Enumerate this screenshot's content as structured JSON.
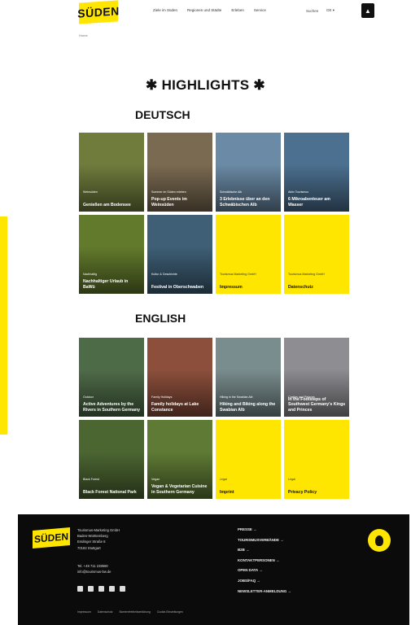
{
  "header": {
    "logo": "SÜDEN",
    "nav": [
      "Ziele im Süden",
      "Regionen und Städte",
      "Erleben",
      "Service"
    ],
    "search_label": "Suchen",
    "lang_label": "DE ▾"
  },
  "breadcrumb": "Home",
  "highlights_title": "✱ HIGHLIGHTS ✱",
  "sections": [
    {
      "heading": "DEUTSCH",
      "tiles": [
        {
          "category": "Weinsüden",
          "title": "Genießen am Bodensee",
          "type": "img",
          "color": "#6f7c3c"
        },
        {
          "category": "Sommer im Süden erleben",
          "title": "Pop-up Events im Weinsüden",
          "type": "img",
          "color": "#7b6a52"
        },
        {
          "category": "Schwäbische Alb",
          "title": "3 Erlebnisse über an den Schwäbischen Alb",
          "type": "img",
          "color": "#6b8aa5"
        },
        {
          "category": "Aktiv Tourismus",
          "title": "6 Mikroabenteuer am Wasser",
          "type": "img",
          "color": "#4c7090"
        },
        {
          "category": "Nachhaltig",
          "title": "Nachhaltiger Urlaub in BaWü",
          "type": "img",
          "color": "#627a2c"
        },
        {
          "category": "Kultur & Geschichte",
          "title": "Festival in Oberschwaben",
          "type": "img",
          "color": "#3e5f76"
        },
        {
          "category": "Tourismus Marketing GmbH",
          "title": "Impressum",
          "type": "yellow",
          "color": "#ffe600"
        },
        {
          "category": "Tourismus Marketing GmbH",
          "title": "Datenschutz",
          "type": "yellow",
          "color": "#ffe600"
        }
      ]
    },
    {
      "heading": "ENGLISH",
      "tiles": [
        {
          "category": "Outdoor",
          "title": "Active Adventures by the Rivers in Southern Germany",
          "type": "img",
          "color": "#4e6b48"
        },
        {
          "category": "Family Holidays",
          "title": "Family holidays at Lake Constance",
          "type": "img",
          "color": "#8c4f3c"
        },
        {
          "category": "Hiking in the Swabian Alb",
          "title": "Hiking and Biking along the Swabian Alb",
          "type": "img",
          "color": "#7a8d8e"
        },
        {
          "category": "Castles and Palaces",
          "title": "In the Footsteps of Southwest Germany's Kings and Princes",
          "type": "img",
          "color": "#8d8d92"
        },
        {
          "category": "Black Forest",
          "title": "Black Forest National Park",
          "type": "img",
          "color": "#4c6632"
        },
        {
          "category": "Vegan",
          "title": "Vegan & Vegetarian Cuisine in Southern Germany",
          "type": "img",
          "color": "#5f7a35"
        },
        {
          "category": "Legal",
          "title": "Imprint",
          "type": "yellow",
          "color": "#ffe600"
        },
        {
          "category": "Legal",
          "title": "Privacy Policy",
          "type": "yellow",
          "color": "#ffe600"
        }
      ]
    }
  ],
  "footer": {
    "logo": "SÜDEN",
    "address": [
      "Tourismus-Marketing GmbH",
      "Baden-Württemberg",
      "Esslinger Straße 8",
      "70182 Stuttgart"
    ],
    "contact": [
      "Tel. +49 711 238580",
      "info@tourismus-bw.de"
    ],
    "social": [
      "facebook-icon",
      "youtube-icon",
      "instagram-icon",
      "pinterest-icon",
      "linkedin-icon"
    ],
    "legal": [
      "Impressum",
      "Datenschutz",
      "Barrierefreiheitserklärung",
      "Cookie-Einstellungen"
    ],
    "links": [
      "PRESSE →",
      "TOURISMUSVERBÄNDE →",
      "B2B →",
      "KONTAKTPERSONEN →",
      "OPEN DATA →",
      "JOBS/FAQ →",
      "NEWSLETTER-ANMELDUNG →"
    ]
  },
  "colors": {
    "accent": "#ffe600",
    "footer_bg": "#0b0b0b"
  }
}
